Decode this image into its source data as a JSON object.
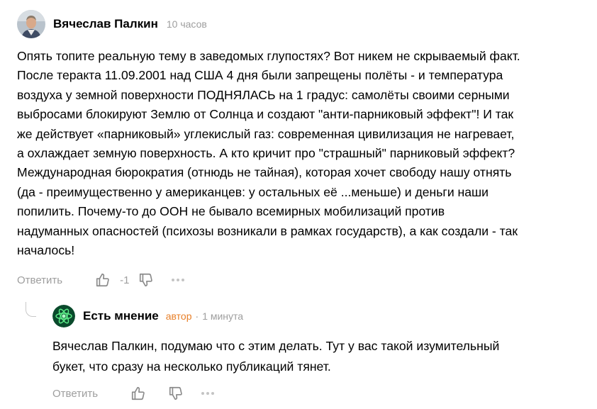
{
  "comment": {
    "author": "Вячеслав Палкин",
    "time": "10 часов",
    "text_lines": [
      "Опять топите реальную тему в заведомых глупостях? Вот никем не скрываемый факт.",
      "После теракта 11.09.2001 над США 4 дня были запрещены полёты - и температура",
      "воздуха у земной поверхности ПОДНЯЛАСЬ на 1 градус: самолёты своими серными",
      "выбросами блокируют Землю от Солнца и создают \"анти-парниковый эффект\"! И так",
      "же действует «парниковый» углекислый газ: современная цивилизация не нагревает,",
      "а охлаждает земную поверхность. А кто кричит про \"страшный\" парниковый эффект?",
      "Международная бюрократия (отнюдь не тайная), которая хочет свободу нашу отнять",
      "(да - преимущественно у американцев: у остальных её ...меньше) и деньги наши",
      "попилить. Почему-то до ООН не бывало всемирных мобилизаций против",
      "надуманных опасностей (психозы возникали в рамках государств), а как создали - так",
      "началось!"
    ],
    "actions": {
      "reply_label": "Ответить",
      "vote_count": "-1"
    }
  },
  "reply": {
    "author": "Есть мнение",
    "badge": "автор",
    "separator": "·",
    "time": "1 минута",
    "text_lines": [
      "Вячеслав Палкин, подумаю что с этим делать. Тут у вас такой изумительный",
      "букет, что сразу на несколько публикаций тянет."
    ],
    "actions": {
      "reply_label": "Ответить"
    }
  },
  "icons": {
    "like": "thumbs-up-icon",
    "dislike": "thumbs-down-icon",
    "more": "more-dots-icon",
    "reply_avatar": "atom-icon"
  },
  "colors": {
    "muted": "#9e9e9e",
    "author_badge": "#e8802a",
    "thread_line": "#c8c8c8",
    "reply_avatar_bg": "#0a4a2c",
    "reply_avatar_accent": "#5ef08a"
  }
}
